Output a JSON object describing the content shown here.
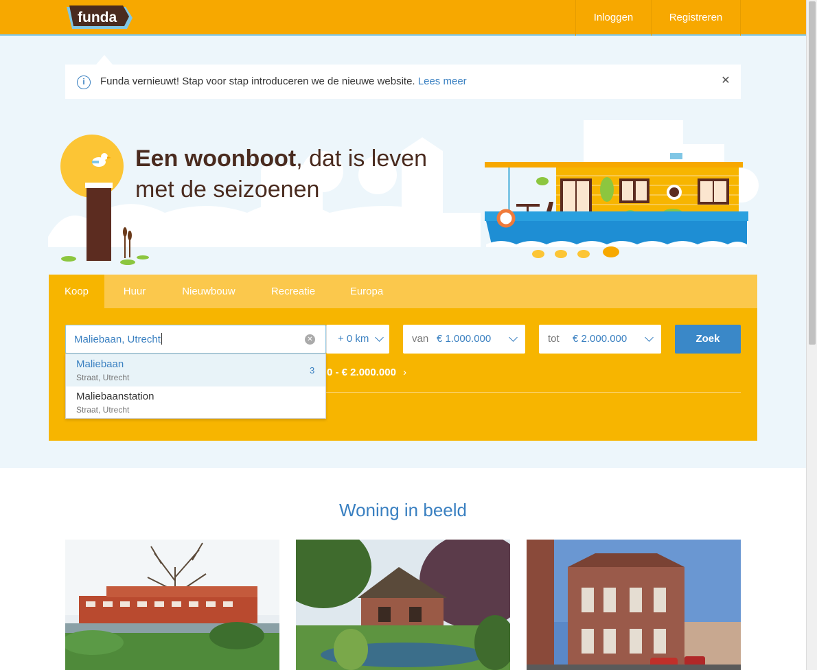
{
  "colors": {
    "brand_orange": "#f7a800",
    "panel_yellow": "#f7b500",
    "link_blue": "#3a80c1",
    "button_blue": "#3a88c8",
    "logo_brown": "#4a2b1f"
  },
  "header": {
    "logo_text": "funda",
    "login_label": "Inloggen",
    "register_label": "Registreren"
  },
  "notice": {
    "icon": "info-icon",
    "text": "Funda vernieuwt! Stap voor stap introduceren we de nieuwe website.",
    "link": "Lees meer",
    "close_icon": "close-icon"
  },
  "hero": {
    "title_bold": "Een woonboot",
    "title_rest_line1": ", dat is leven",
    "title_line2": "met de seizoenen"
  },
  "search": {
    "tabs": [
      {
        "label": "Koop",
        "active": true
      },
      {
        "label": "Huur",
        "active": false
      },
      {
        "label": "Nieuwbouw",
        "active": false
      },
      {
        "label": "Recreatie",
        "active": false
      },
      {
        "label": "Europa",
        "active": false
      }
    ],
    "location_value": "Maliebaan, Utrecht",
    "radius_value": "+ 0 km",
    "price_from_label": "van",
    "price_from_value": "€ 1.000.000",
    "price_to_label": "tot",
    "price_to_value": "€ 2.000.000",
    "submit_label": "Zoek",
    "saved_search_text": "0 - € 2.000.000",
    "saved_search_chevron": "›"
  },
  "autocomplete": [
    {
      "title": "Maliebaan",
      "subtitle": "Straat, Utrecht",
      "count": "3",
      "highlighted": true
    },
    {
      "title": "Maliebaanstation",
      "subtitle": "Straat, Utrecht",
      "count": "",
      "highlighted": false
    }
  ],
  "featured": {
    "title": "Woning in beeld"
  }
}
